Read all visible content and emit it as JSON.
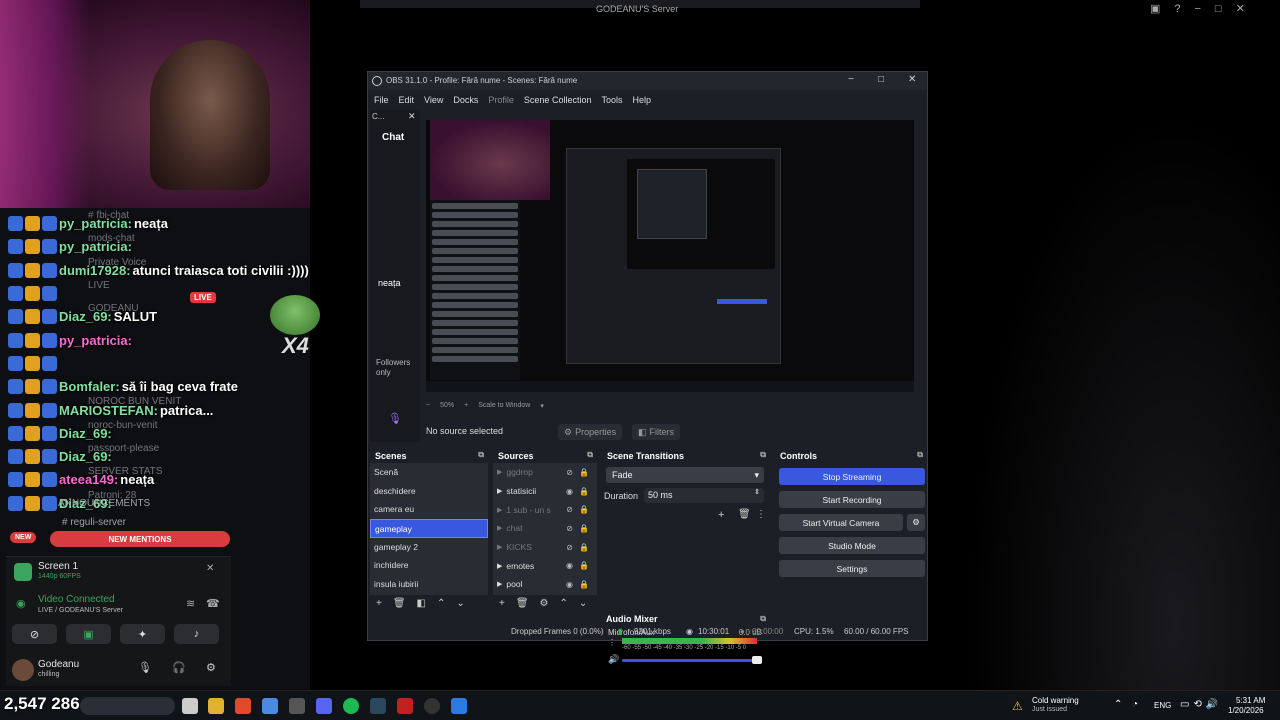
{
  "discord_top": {
    "server_title": "GODEANU'S Server"
  },
  "chat_overlay": [
    {
      "user": "py_patricia:",
      "msg": "neața",
      "ghost": "# fbi-chat"
    },
    {
      "user": "py_patricia:",
      "msg": "",
      "ghost": "mods-chat"
    },
    {
      "user": "dumi17928:",
      "msg": "atunci traiasca toti civilii :))))",
      "ghost": "Private Voice"
    },
    {
      "user": "",
      "msg": "",
      "ghost": "LIVE"
    },
    {
      "user": "Diaz_69:",
      "msg": "SALUT",
      "ghost": "GODEANU"
    },
    {
      "user": "py_patricia:",
      "msg": "",
      "ghost": "",
      "pink": true
    },
    {
      "user": "",
      "msg": "",
      "ghost": ""
    },
    {
      "user": "Bomfaler:",
      "msg": "să îi bag ceva frate",
      "ghost": ""
    },
    {
      "user": "MARIOSTEFAN:",
      "msg": "patrica...",
      "ghost": "NOROC BUN VENIT"
    },
    {
      "user": "Diaz_69:",
      "msg": "",
      "ghost": "noroc-bun-venit"
    },
    {
      "user": "Diaz_69:",
      "msg": "",
      "ghost": "passport-please"
    },
    {
      "user": "ateea149:",
      "msg": "neața",
      "ghost": "SERVER STATS",
      "pink": true
    },
    {
      "user": "Diaz_69:",
      "msg": "",
      "ghost": "Patroni: 28"
    }
  ],
  "overlay": {
    "live": "LIVE",
    "pepe_count": "X4"
  },
  "discord": {
    "announcements": "ANNOUNCEMENTS",
    "reguli": "reguli-server",
    "new_badge": "NEW",
    "new_mentions": "NEW MENTIONS",
    "screen_title": "Screen 1",
    "screen_sub": "1440p 60FPS",
    "vc_title": "Video Connected",
    "vc_sub": "LIVE / GODEANU'S Server",
    "user_name": "Godeanu",
    "user_status": "chilling"
  },
  "obs": {
    "title": "OBS 31.1.0 - Profile: Fără nume - Scenes: Fără nume",
    "menu": [
      "File",
      "Edit",
      "View",
      "Docks",
      "Profile",
      "Scene Collection",
      "Tools",
      "Help"
    ],
    "chat_dock_head": "C...",
    "chat_dock_title": "Chat",
    "chat_dock_msg": "neața",
    "followers": "Followers only",
    "zoom": "50%",
    "scale": "Scale to Window",
    "no_source": "No source selected",
    "properties": "Properties",
    "filters": "Filters",
    "scenes_title": "Scenes",
    "scenes": [
      "Scenă",
      "deschidere",
      "camera eu",
      "gameplay",
      "gameplay 2",
      "inchidere",
      "insula iubirii"
    ],
    "sources_title": "Sources",
    "sources": [
      {
        "name": "ggdrop",
        "hidden": true
      },
      {
        "name": "statisicii",
        "hidden": false
      },
      {
        "name": "1 sub - un s",
        "hidden": true
      },
      {
        "name": "chat",
        "hidden": true
      },
      {
        "name": "KICKS",
        "hidden": true
      },
      {
        "name": "emotes",
        "hidden": false
      },
      {
        "name": "pool",
        "hidden": false
      }
    ],
    "transitions_title": "Scene Transitions",
    "transition": "Fade",
    "duration_label": "Duration",
    "duration_value": "50 ms",
    "mixer_title": "Audio Mixer",
    "mic_label": "Microfon/Aux",
    "mic_db": "0.0 dB",
    "meter_scale": "-60 -55 -50 -45 -40 -35 -30 -25 -20 -15 -10 -5 0",
    "controls_title": "Controls",
    "controls": [
      "Stop Streaming",
      "Start Recording",
      "Start Virtual Camera",
      "Studio Mode",
      "Settings"
    ],
    "status": {
      "dropped": "Dropped Frames 0 (0.0%)",
      "kbps": "9201 kbps",
      "stream_time": "10:30:01",
      "rec_time": "00:00:00",
      "cpu": "CPU: 1.5%",
      "fps": "60.00 / 60.00 FPS"
    }
  },
  "taskbar": {
    "viewers_a": "2,547",
    "viewers_b": "286",
    "cold_warning": "Cold warning",
    "cold_sub": "Just issued",
    "lang": "ENG",
    "time": "5:31 AM",
    "date": "1/20/2026"
  },
  "colors": {
    "obs_accent": "#3a57e0",
    "discord_green": "#3ba55d",
    "discord_red": "#d83c3e"
  }
}
